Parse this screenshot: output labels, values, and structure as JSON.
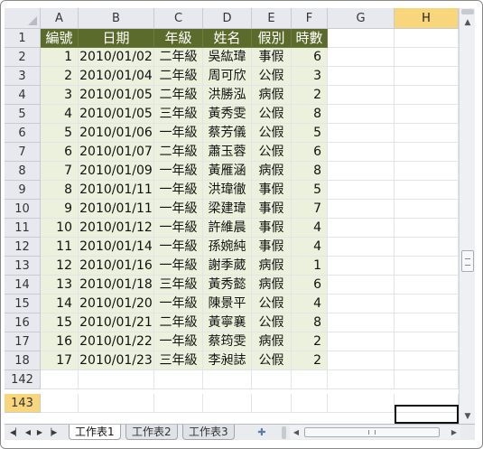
{
  "columns": [
    "A",
    "B",
    "C",
    "D",
    "E",
    "F",
    "G",
    "H"
  ],
  "selected_column": "H",
  "header_row": {
    "row_label": "1",
    "cells": [
      "編號",
      "日期",
      "年級",
      "姓名",
      "假別",
      "時數"
    ]
  },
  "rows": [
    {
      "row_label": "2",
      "cells": [
        "1",
        "2010/01/02",
        "二年級",
        "吳紘瑋",
        "事假",
        "6"
      ]
    },
    {
      "row_label": "3",
      "cells": [
        "2",
        "2010/01/04",
        "二年級",
        "周可欣",
        "公假",
        "3"
      ]
    },
    {
      "row_label": "4",
      "cells": [
        "3",
        "2010/01/05",
        "二年級",
        "洪勝泓",
        "病假",
        "2"
      ]
    },
    {
      "row_label": "5",
      "cells": [
        "4",
        "2010/01/05",
        "三年級",
        "黃秀雯",
        "公假",
        "8"
      ]
    },
    {
      "row_label": "6",
      "cells": [
        "5",
        "2010/01/06",
        "一年級",
        "蔡芳儀",
        "公假",
        "5"
      ]
    },
    {
      "row_label": "7",
      "cells": [
        "6",
        "2010/01/07",
        "二年級",
        "蕭玉蓉",
        "公假",
        "6"
      ]
    },
    {
      "row_label": "8",
      "cells": [
        "7",
        "2010/01/09",
        "一年級",
        "黃雁涵",
        "病假",
        "8"
      ]
    },
    {
      "row_label": "9",
      "cells": [
        "8",
        "2010/01/11",
        "一年級",
        "洪瑋徹",
        "事假",
        "5"
      ]
    },
    {
      "row_label": "10",
      "cells": [
        "9",
        "2010/01/11",
        "一年級",
        "梁建瑋",
        "事假",
        "7"
      ]
    },
    {
      "row_label": "11",
      "cells": [
        "10",
        "2010/01/12",
        "一年級",
        "許維晨",
        "事假",
        "4"
      ]
    },
    {
      "row_label": "12",
      "cells": [
        "11",
        "2010/01/14",
        "一年級",
        "孫婉純",
        "事假",
        "4"
      ]
    },
    {
      "row_label": "13",
      "cells": [
        "12",
        "2010/01/16",
        "一年級",
        "謝季葳",
        "病假",
        "1"
      ]
    },
    {
      "row_label": "14",
      "cells": [
        "13",
        "2010/01/18",
        "三年級",
        "黃秀懿",
        "病假",
        "6"
      ]
    },
    {
      "row_label": "15",
      "cells": [
        "14",
        "2010/01/20",
        "一年級",
        "陳景平",
        "公假",
        "4"
      ]
    },
    {
      "row_label": "16",
      "cells": [
        "15",
        "2010/01/21",
        "二年級",
        "黃寧襄",
        "公假",
        "8"
      ]
    },
    {
      "row_label": "17",
      "cells": [
        "16",
        "2010/01/22",
        "一年級",
        "蔡筠雯",
        "病假",
        "2"
      ]
    },
    {
      "row_label": "18",
      "cells": [
        "17",
        "2010/01/23",
        "三年級",
        "李昶誌",
        "公假",
        "2"
      ]
    }
  ],
  "extra_rows": [
    {
      "row_label": "142"
    },
    {
      "row_label": "143",
      "selected": true
    }
  ],
  "sheet_tabs": [
    {
      "label": "工作表1",
      "active": true
    },
    {
      "label": "工作表2",
      "active": false
    },
    {
      "label": "工作表3",
      "active": false
    }
  ],
  "icons": {
    "nav_first": "first-sheet-icon",
    "nav_prev": "prev-sheet-icon",
    "nav_next": "next-sheet-icon",
    "nav_last": "last-sheet-icon",
    "new_sheet": "insert-sheet-icon"
  },
  "colors": {
    "header_fill": "#5b6b2c",
    "data_fill": "#ebf1dc",
    "selected_header": "#f8d77c"
  }
}
